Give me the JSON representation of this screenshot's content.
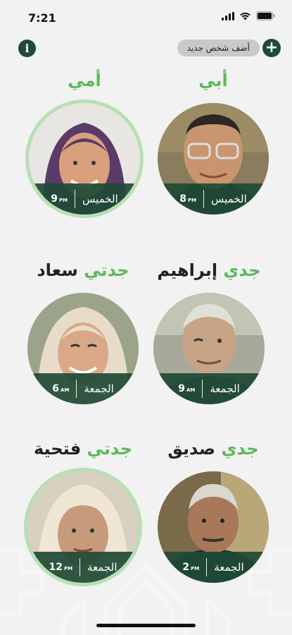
{
  "status_bar": {
    "time": "7:21"
  },
  "header": {
    "add_person_label": "أضف شخص جديد",
    "info_icon": "info-icon",
    "add_icon": "plus-icon"
  },
  "people": [
    {
      "prefix": "",
      "title": "أبي",
      "name": "",
      "day": "الخميس",
      "time": "8",
      "ampm": "PM",
      "selected": false
    },
    {
      "prefix": "",
      "title": "أمي",
      "name": "",
      "day": "الخميس",
      "time": "9",
      "ampm": "PM",
      "selected": true
    },
    {
      "prefix": "",
      "title": "جدي",
      "name": "إبراهيم",
      "day": "الجمعة",
      "time": "9",
      "ampm": "AM",
      "selected": false
    },
    {
      "prefix": "",
      "title": "جدتي",
      "name": "سعاد",
      "day": "الجمعة",
      "time": "6",
      "ampm": "AM",
      "selected": false
    },
    {
      "prefix": "",
      "title": "جدي",
      "name": "صديق",
      "day": "الجمعة",
      "time": "2",
      "ampm": "PM",
      "selected": false
    },
    {
      "prefix": "",
      "title": "جدتي",
      "name": "فتحية",
      "day": "الجمعة",
      "time": "12",
      "ampm": "PM",
      "selected": true
    }
  ],
  "colors": {
    "accent_green": "#5cb85c",
    "dark_green": "#1f4a35",
    "ring": "#b8dfb5"
  }
}
